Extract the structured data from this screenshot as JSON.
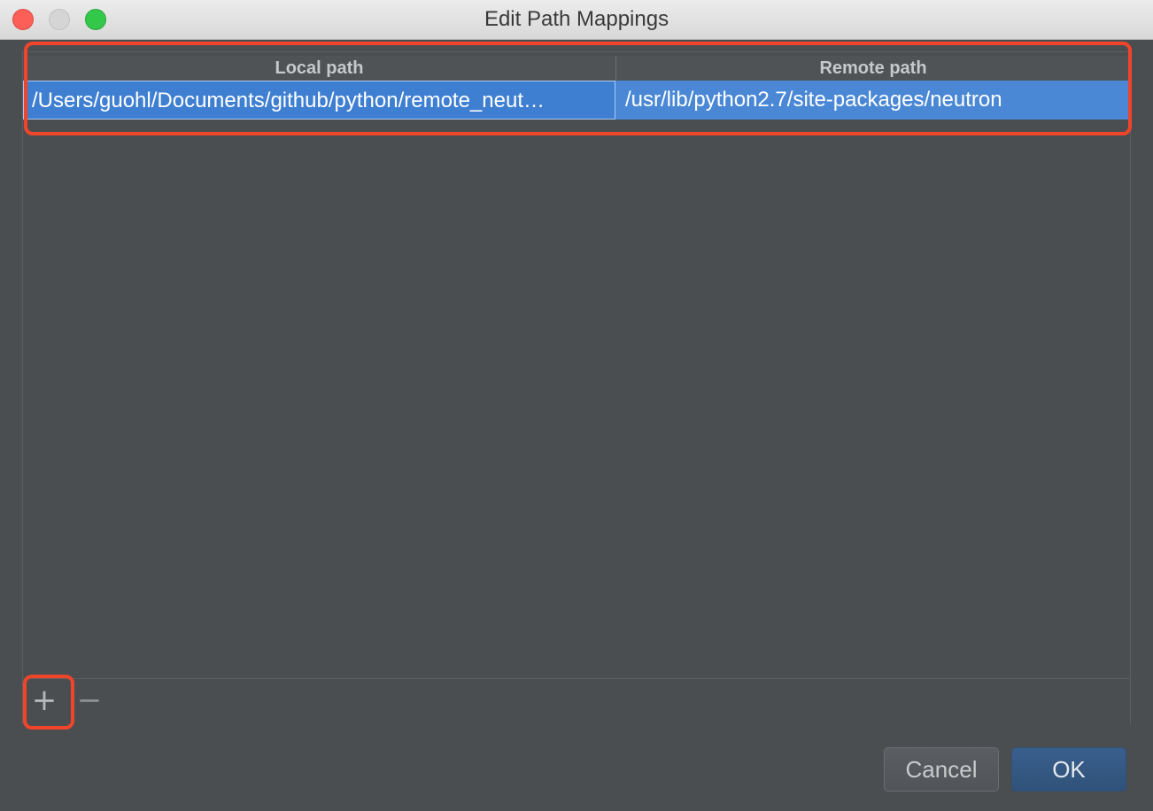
{
  "window": {
    "title": "Edit Path Mappings",
    "controls": {
      "close": "close-button",
      "minimize": "minimize-button",
      "maximize": "maximize-button"
    }
  },
  "table": {
    "columns": [
      "Local path",
      "Remote path"
    ],
    "rows": [
      {
        "local": "/Users/guohl/Documents/github/python/remote_neut…",
        "remote": "/usr/lib/python2.7/site-packages/neutron",
        "selected": true
      }
    ]
  },
  "toolbar": {
    "add_label": "+",
    "remove_label": "−"
  },
  "buttons": {
    "cancel": "Cancel",
    "ok": "OK"
  },
  "colors": {
    "selection": "#4a88d6",
    "annotation": "#f0452a",
    "ok_button": "#30527a"
  }
}
